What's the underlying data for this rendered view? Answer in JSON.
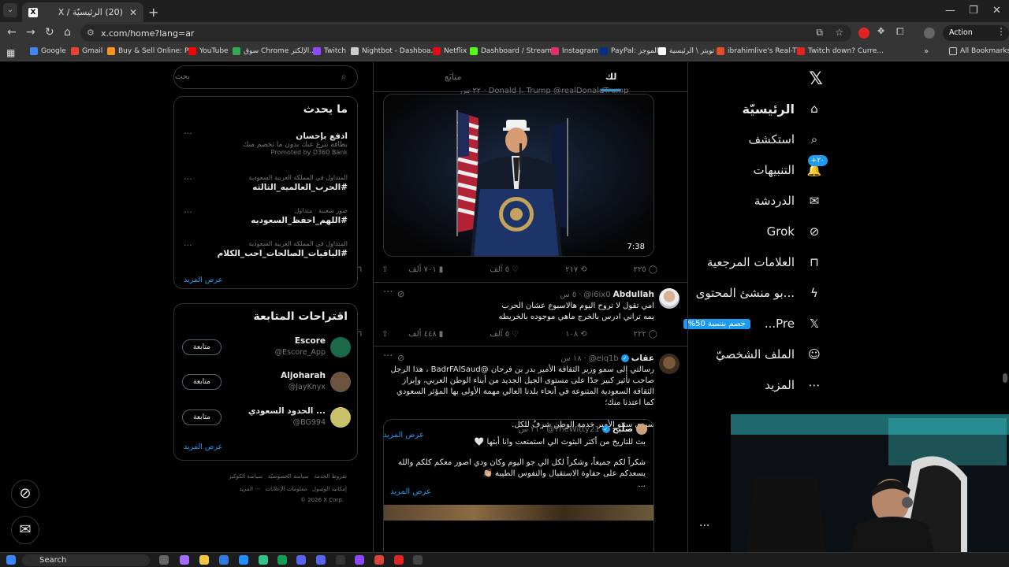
{
  "browser": {
    "tab_title": "(20) الرئيسيّة / X",
    "url": "x.com/home?lang=ar",
    "action_required": "Action required",
    "bookmarks": [
      {
        "label": "Google",
        "color": "#4285f4"
      },
      {
        "label": "Gmail",
        "color": "#ea4335"
      },
      {
        "label": "Buy & Sell Online: P...",
        "color": "#f7941d"
      },
      {
        "label": "YouTube",
        "color": "#ff0000"
      },
      {
        "label": "سوق Chrome الإلكتر...",
        "color": "#34a853"
      },
      {
        "label": "Twitch",
        "color": "#9146ff"
      },
      {
        "label": "Nightbot - Dashboa...",
        "color": "#cccccc"
      },
      {
        "label": "Netflix",
        "color": "#e50914"
      },
      {
        "label": "Dashboard / Stream...",
        "color": "#53fc18"
      },
      {
        "label": "Instagram",
        "color": "#e1306c"
      },
      {
        "label": "PayPal: الموجز",
        "color": "#003087"
      },
      {
        "label": "تويتر \\ الرئيسية",
        "color": "#ffffff"
      },
      {
        "label": "ibrahimlive's Real-Ti...",
        "color": "#e34f26"
      },
      {
        "label": "Twitch down? Curre...",
        "color": "#e02424"
      }
    ],
    "all_bookmarks": "All Bookmarks"
  },
  "nav": {
    "items": [
      {
        "label": "الرئيسيّة",
        "icon": "home-icon"
      },
      {
        "label": "استكشف",
        "icon": "search-icon"
      },
      {
        "label": "التنبيهات",
        "icon": "bell-icon",
        "badge": "+٢٠"
      },
      {
        "label": "الدردشة",
        "icon": "mail-icon"
      },
      {
        "label": "Grok",
        "icon": "grok-icon"
      },
      {
        "label": "العلامات المرجعية",
        "icon": "bookmark-icon"
      },
      {
        "label": "...بو منشئ المحتوى",
        "icon": "creator-icon"
      },
      {
        "label": "Pre...",
        "icon": "x-premium-icon",
        "badge": "خصم بنسبة 50%"
      },
      {
        "label": "الملف الشخصيّ",
        "icon": "profile-icon"
      },
      {
        "label": "المزيد",
        "icon": "more-icon"
      }
    ]
  },
  "timeline": {
    "tab_for_you": "لك",
    "tab_following": "متابَع",
    "top_post_author": "Donald J. Trump @realDonaldTrump · ٢٢ س",
    "video_duration": "7:38",
    "post1_stats": {
      "replies": "٢٢٥",
      "reposts": "٢١٧",
      "likes": "٥ آلف",
      "views": "٧٠١ ألف"
    },
    "post2": {
      "name": "Abdullah",
      "handle": "@i6ix0",
      "time": "٥ س",
      "lines": [
        "امي تقول لا تروح اليوم هالاسبوع عشان الحرب",
        "يمه تراني ادرس بالخرج ماهي موجوده بالخريطه"
      ],
      "stats": {
        "replies": "٢٢٢",
        "reposts": "١٠٨",
        "likes": "٥ آلف",
        "views": "٤٤٨ ألف"
      }
    },
    "post3": {
      "name": "عقاب",
      "handle": "@eiq1b",
      "time": "١٨ س",
      "lines": [
        "رسالتي إلى سمو وزير الثقافة الأمير بدر بن فرحان @BadrFAlSaud ، هذا الرجل",
        "صاحب تأثير كبير جدًا على مستوى الجيل الجديد من أبناء الوطن العربي، وإبراز",
        "الثقافة السعودية المتنوعة في أنحاء بلدنا العالي مهمة الأولى بها المؤثر السعودي",
        "كما اعتدنا منك؛"
      ],
      "line_last": "سيدي سمو الأمير خدمة الوطن شرفٌ للكل.",
      "show_more": "عرض المزيد"
    },
    "quote": {
      "name": "صلّبح",
      "handle": "@TheWitty21",
      "time": "٢١ س",
      "line1": "بث للتاريخ من أكثر البثوث الي استمتعت وانا أبثها 🤍",
      "line2": "شكراً لكم جميعاً، وشكراً لكل الي جو اليوم وكان ودي اصور معكم كلكم والله",
      "line3": "يسعدكم على حفاوة الاستقبال والنفوس الطيبة 👏🏼",
      "ellipsis": "...",
      "show_more": "عرض المزيد"
    }
  },
  "sidebar": {
    "search_placeholder": "بحث",
    "trends_title": "ما يحدث",
    "trends": [
      {
        "meta": "",
        "name": "ادفع بإحسان",
        "desc": "بطاقة تبرع عنك بدون ما تخصم منك",
        "promoted": "Promoted by D360 Bank"
      },
      {
        "meta": "المتداول في المملكة العربية السعودية",
        "name": "#الحرب_العالميه_الثالثه"
      },
      {
        "meta": "صور شعبية · متداول",
        "name": "#اللهم_احفظ_السعوديه"
      },
      {
        "meta": "المتداول في المملكة العربية السعودية",
        "name": "#الباقيات_الصالحات_احب_الكلام"
      }
    ],
    "show_more": "عرض المزيد",
    "who_title": "اقتراحات المتابعة",
    "suggestions": [
      {
        "name": "Escore",
        "handle": "@Escore_App",
        "color": "#1b6b4a"
      },
      {
        "name": "Aljoharah",
        "handle": "@JayKnyx",
        "color": "#6b5540"
      },
      {
        "name": "الحدود السعودي ...",
        "handle": "@BG994",
        "color": "#c9c06a"
      }
    ],
    "follow_label": "متابعة",
    "footer_lines": [
      "شروط الخدمة",
      "سياسة الخصوصيّة",
      "سياسة الكوكيز",
      "إمكانية الوصول",
      "معلومات الإعلانات",
      "··· المزيد",
      "© 2026 X Corp."
    ]
  },
  "taskbar": {
    "search": "Search"
  }
}
